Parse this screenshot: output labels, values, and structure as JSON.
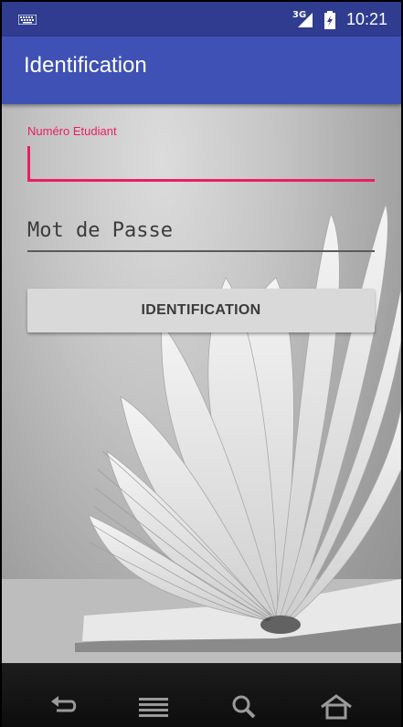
{
  "status_bar": {
    "keyboard_icon": "keyboard-icon",
    "network_label": "3G",
    "time": "10:21"
  },
  "app_bar": {
    "title": "Identification"
  },
  "form": {
    "student_number_label": "Numéro Etudiant",
    "student_number_value": "",
    "password_placeholder": "Mot de Passe",
    "login_button": "IDENTIFICATION"
  },
  "nav_bar": {
    "icons": [
      "back-icon",
      "menu-icon",
      "search-icon",
      "home-icon"
    ]
  },
  "colors": {
    "status_bar": "#2f3c8f",
    "app_bar": "#3f51b5",
    "accent": "#e91e63",
    "button": "#d9d9d9"
  }
}
